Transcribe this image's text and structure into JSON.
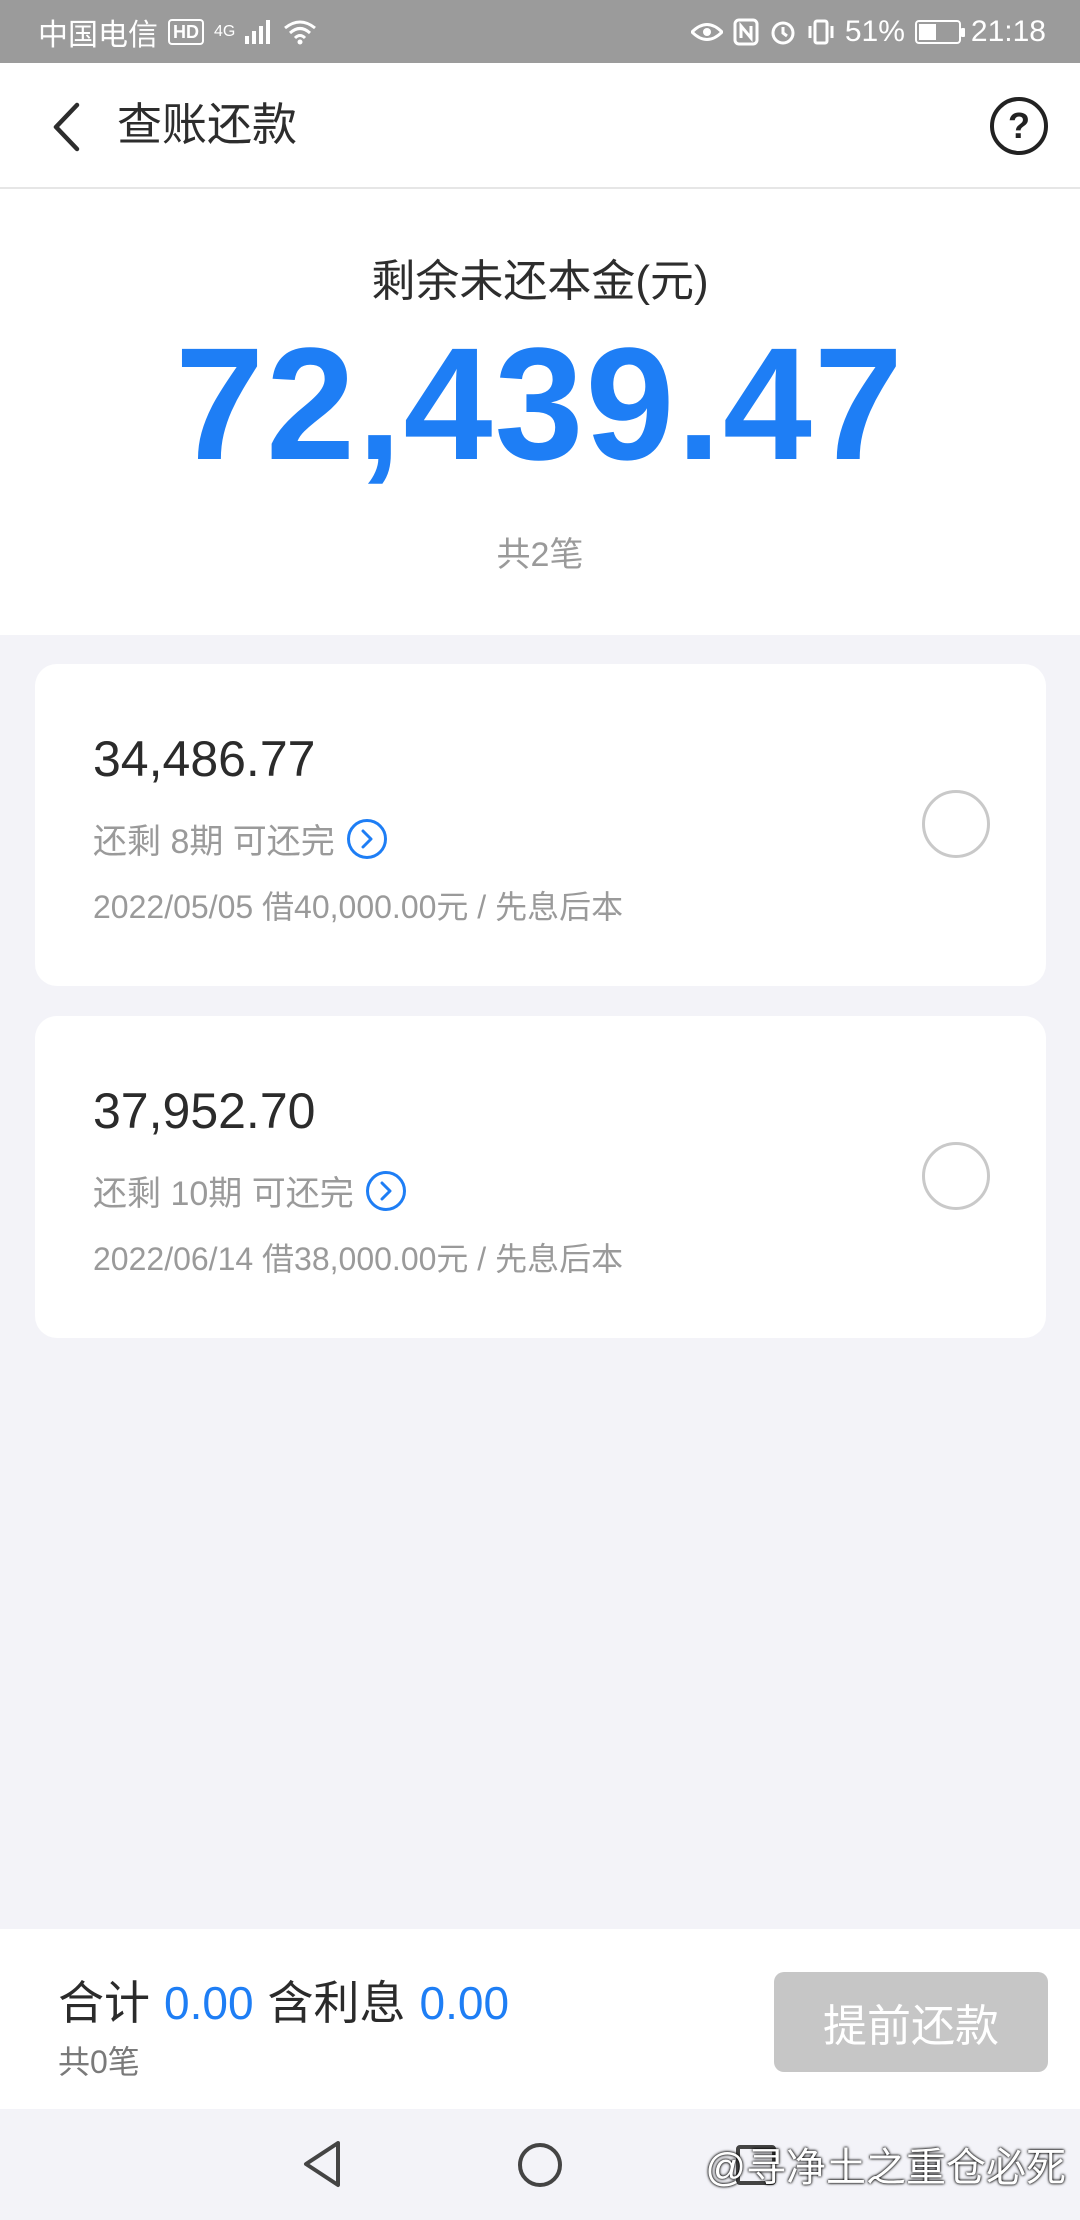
{
  "status_bar": {
    "carrier": "中国电信",
    "hd": "HD",
    "network": "4G",
    "battery_percent": "51%",
    "battery_level": 0.51,
    "time": "21:18"
  },
  "header": {
    "title": "查账还款",
    "help_symbol": "?"
  },
  "summary": {
    "label": "剩余未还本金(元)",
    "amount": "72,439.47",
    "count": "共2笔"
  },
  "loans": [
    {
      "amount": "34,486.77",
      "remaining": "还剩 8期 可还完",
      "detail": "2022/05/05 借40,000.00元 / 先息后本"
    },
    {
      "amount": "37,952.70",
      "remaining": "还剩 10期 可还完",
      "detail": "2022/06/14 借38,000.00元 / 先息后本"
    }
  ],
  "footer": {
    "total_label": "合计",
    "total_value": "0.00",
    "interest_label": "含利息",
    "interest_value": "0.00",
    "count": "共0笔",
    "prepay_button": "提前还款"
  },
  "watermark": "@寻净土之重仓必死",
  "colors": {
    "accent": "#1e7ef5",
    "disabled_button": "#c6c6c6",
    "background": "#f3f3f8"
  }
}
